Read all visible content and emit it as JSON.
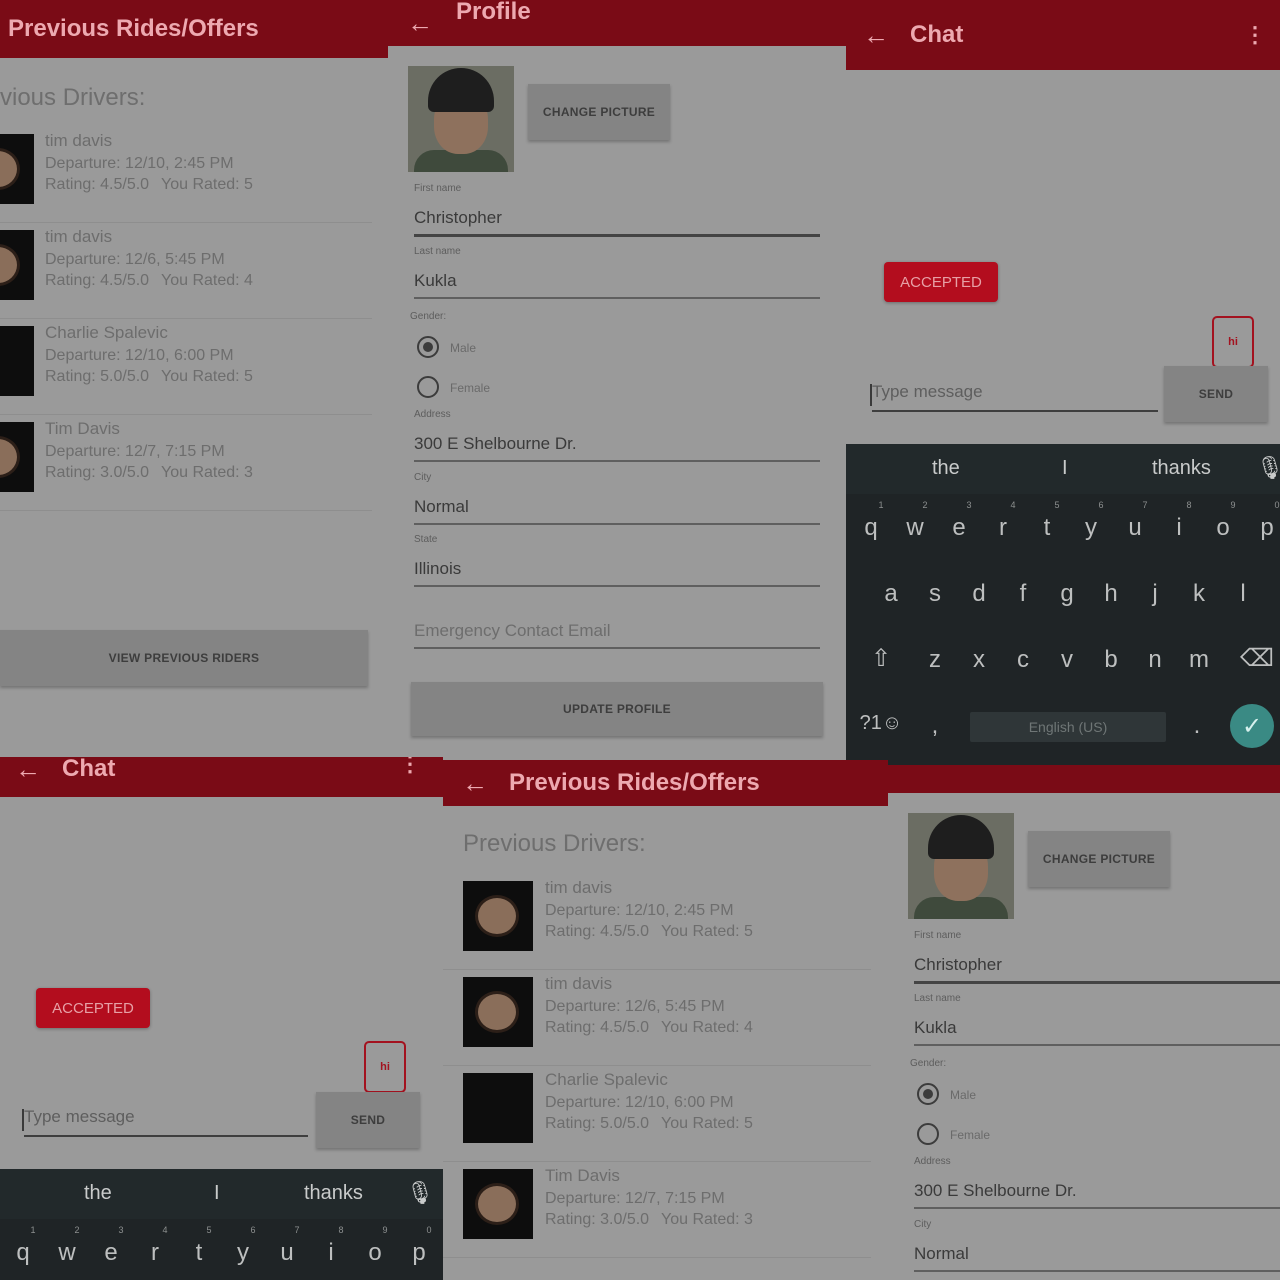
{
  "colors": {
    "brand": "#7a0b16",
    "accent": "#b30d1e",
    "keyboard": "#1f2426",
    "done_key": "#3a8a84"
  },
  "rides": {
    "title": "Previous Rides/Offers",
    "heading": "Previous Drivers:",
    "heading_cropped": "vious Drivers:",
    "button": "VIEW PREVIOUS RIDERS",
    "items": [
      {
        "name": "tim davis",
        "departure": "Departure: 12/10, 2:45 PM",
        "rating": "Rating: 4.5/5.0",
        "rated": "You Rated: 5",
        "photo": "face"
      },
      {
        "name": "tim davis",
        "departure": "Departure: 12/6, 5:45 PM",
        "rating": "Rating: 4.5/5.0",
        "rated": "You Rated: 4",
        "photo": "face"
      },
      {
        "name": "Charlie Spalevic",
        "departure": "Departure: 12/10, 6:00 PM",
        "rating": "Rating: 5.0/5.0",
        "rated": "You Rated: 5",
        "photo": "none"
      },
      {
        "name": "Tim Davis",
        "departure": "Departure: 12/7, 7:15 PM",
        "rating": "Rating: 3.0/5.0",
        "rated": "You Rated: 3",
        "photo": "face"
      }
    ]
  },
  "profile": {
    "title": "Profile",
    "change_picture": "CHANGE PICTURE",
    "first_name_label": "First name",
    "first_name": "Christopher",
    "last_name_label": "Last name",
    "last_name": "Kukla",
    "gender_label": "Gender:",
    "gender_options": [
      "Male",
      "Female"
    ],
    "gender_selected": "Male",
    "address_label": "Address",
    "address": "300 E Shelbourne Dr.",
    "city_label": "City",
    "city": "Normal",
    "state_label": "State",
    "state": "Illinois",
    "emergency_placeholder": "Emergency Contact Email",
    "update_button": "UPDATE PROFILE"
  },
  "chat": {
    "title": "Chat",
    "menu_icon": "more-vert-icon",
    "status": "ACCEPTED",
    "message": "hi",
    "input_placeholder": "Type message",
    "send": "SEND"
  },
  "keyboard": {
    "suggestions": [
      "the",
      "I",
      "thanks"
    ],
    "row1": [
      "q",
      "w",
      "e",
      "r",
      "t",
      "y",
      "u",
      "i",
      "o",
      "p"
    ],
    "row1_numbers": [
      "1",
      "2",
      "3",
      "4",
      "5",
      "6",
      "7",
      "8",
      "9",
      "0"
    ],
    "row2": [
      "a",
      "s",
      "d",
      "f",
      "g",
      "h",
      "j",
      "k",
      "l"
    ],
    "row3": [
      "z",
      "x",
      "c",
      "v",
      "b",
      "n",
      "m"
    ],
    "symbols": "?1☺",
    "comma": ",",
    "space_label": "English (US)",
    "period": "."
  }
}
